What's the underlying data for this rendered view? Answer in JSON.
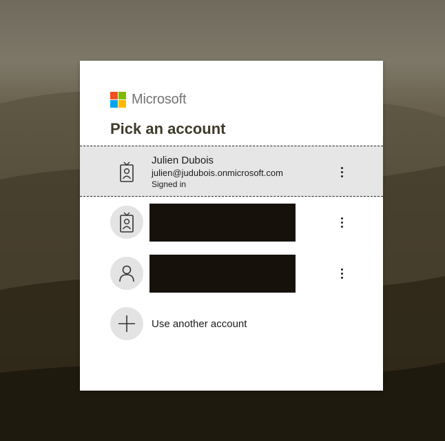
{
  "brand": {
    "name": "Microsoft",
    "logo_colors": [
      "#f25022",
      "#7fba00",
      "#00a4ef",
      "#ffb900"
    ]
  },
  "title": "Pick an account",
  "accounts": [
    {
      "name": "Julien Dubois",
      "email": "julien@judubois.onmicrosoft.com",
      "status": "Signed in",
      "icon": "work-badge-icon",
      "selected": true
    },
    {
      "name": "",
      "email": "",
      "status": "",
      "icon": "work-badge-icon",
      "redacted": true
    },
    {
      "name": "",
      "email": "",
      "status": "",
      "icon": "person-icon",
      "redacted": true
    }
  ],
  "use_another": {
    "label": "Use another account",
    "icon": "plus-icon"
  },
  "more_options_icon": "more-vertical-icon"
}
